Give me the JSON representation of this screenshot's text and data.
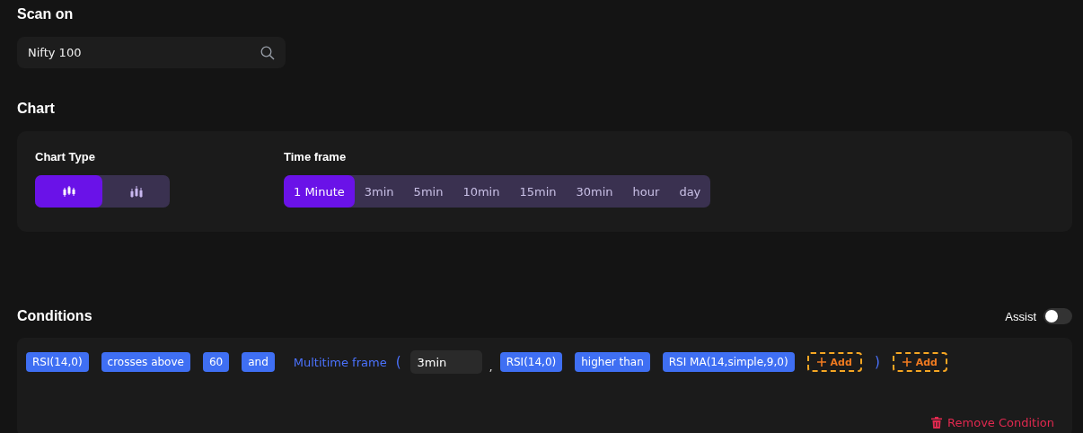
{
  "scan_on": {
    "title": "Scan on",
    "search": {
      "value": "Nifty 100"
    }
  },
  "chart": {
    "title": "Chart",
    "chart_type": {
      "label": "Chart Type",
      "options": [
        {
          "kind": "candles",
          "selected": true
        },
        {
          "kind": "hollow",
          "selected": false
        }
      ]
    },
    "time_frame": {
      "label": "Time frame",
      "options": [
        {
          "label": "1 Minute",
          "selected": true
        },
        {
          "label": "3min",
          "selected": false
        },
        {
          "label": "5min",
          "selected": false
        },
        {
          "label": "10min",
          "selected": false
        },
        {
          "label": "15min",
          "selected": false
        },
        {
          "label": "30min",
          "selected": false
        },
        {
          "label": "hour",
          "selected": false
        },
        {
          "label": "day",
          "selected": false
        }
      ]
    }
  },
  "conditions": {
    "title": "Conditions",
    "assist": {
      "label": "Assist",
      "on": false
    },
    "tokens": [
      {
        "kind": "chip",
        "text": "RSI(14,0)"
      },
      {
        "kind": "chip",
        "text": "crosses above"
      },
      {
        "kind": "chip",
        "text": "60"
      },
      {
        "kind": "chip",
        "text": "and"
      },
      {
        "kind": "link",
        "text": "Multitime frame"
      },
      {
        "kind": "paren",
        "text": "("
      },
      {
        "kind": "field",
        "text": "3min"
      },
      {
        "kind": "comma",
        "text": ","
      },
      {
        "kind": "chip",
        "text": "RSI(14,0)"
      },
      {
        "kind": "chip",
        "text": "higher than"
      },
      {
        "kind": "chip",
        "text": "RSI MA(14,simple,9,0)"
      },
      {
        "kind": "add",
        "text": "Add"
      },
      {
        "kind": "paren",
        "text": ")"
      },
      {
        "kind": "add",
        "text": "Add"
      }
    ],
    "remove": "Remove Condition"
  }
}
